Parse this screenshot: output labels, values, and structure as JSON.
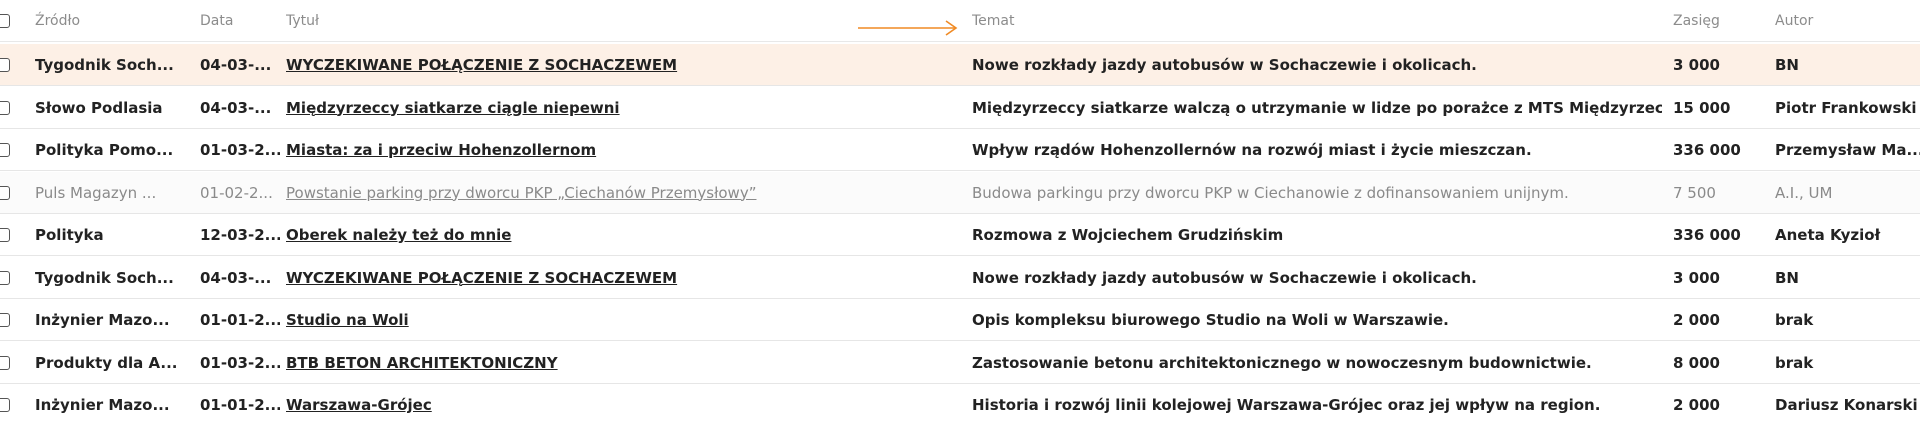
{
  "header": {
    "source": "Źródło",
    "date": "Data",
    "title": "Tytuł",
    "topic": "Temat",
    "reach": "Zasięg",
    "author": "Autor"
  },
  "accent_color": "#f08a24",
  "rows": [
    {
      "source": "Tygodnik Soch...",
      "date": "04-03-...",
      "title": "WYCZEKIWANE POŁĄCZENIE Z SOCHACZEWEM",
      "topic": "Nowe rozkłady jazdy autobusów w Sochaczewie i okolicach.",
      "reach": "3 000",
      "author": "BN"
    },
    {
      "source": "Słowo Podlasia",
      "date": "04-03-...",
      "title": "Międzyrzeccy siatkarze ciągle niepewni",
      "topic": "Międzyrzeccy siatkarze walczą o utrzymanie w lidze po porażce z MTS Międzyrzec ...",
      "reach": "15 000",
      "author": "Piotr Frankowski"
    },
    {
      "source": "Polityka Pomo...",
      "date": "01-03-2...",
      "title": "Miasta: za i przeciw Hohenzollernom",
      "topic": "Wpływ rządów Hohenzollernów na rozwój miast i życie mieszczan.",
      "reach": "336 000",
      "author": "Przemysław Ma..."
    },
    {
      "source": "Puls Magazyn ...",
      "date": "01-02-2...",
      "title": "Powstanie parking przy dworcu PKP „Ciechanów Przemysłowy”",
      "topic": "Budowa parkingu przy dworcu PKP w Ciechanowie z dofinansowaniem unijnym.",
      "reach": "7 500",
      "author": "A.I., UM"
    },
    {
      "source": "Polityka",
      "date": "12-03-2...",
      "title": "Oberek należy też do mnie",
      "topic": "Rozmowa z Wojciechem Grudzińskim",
      "reach": "336 000",
      "author": "Aneta Kyzioł"
    },
    {
      "source": "Tygodnik Soch...",
      "date": "04-03-...",
      "title": "WYCZEKIWANE POŁĄCZENIE Z SOCHACZEWEM",
      "topic": "Nowe rozkłady jazdy autobusów w Sochaczewie i okolicach.",
      "reach": "3 000",
      "author": "BN"
    },
    {
      "source": "Inżynier Mazo...",
      "date": "01-01-2...",
      "title": "Studio na Woli",
      "topic": "Opis kompleksu biurowego Studio na Woli w Warszawie.",
      "reach": "2 000",
      "author": "brak"
    },
    {
      "source": "Produkty dla A...",
      "date": "01-03-2...",
      "title": "BTB BETON ARCHITEKTONICZNY",
      "topic": "Zastosowanie betonu architektonicznego w nowoczesnym budownictwie.",
      "reach": "8 000",
      "author": "brak"
    },
    {
      "source": "Inżynier Mazo...",
      "date": "01-01-2...",
      "title": "Warszawa-Grójec",
      "topic": "Historia i rozwój linii kolejowej Warszawa-Grójec oraz jej wpływ na region.",
      "reach": "2 000",
      "author": "Dariusz Konarski"
    }
  ]
}
